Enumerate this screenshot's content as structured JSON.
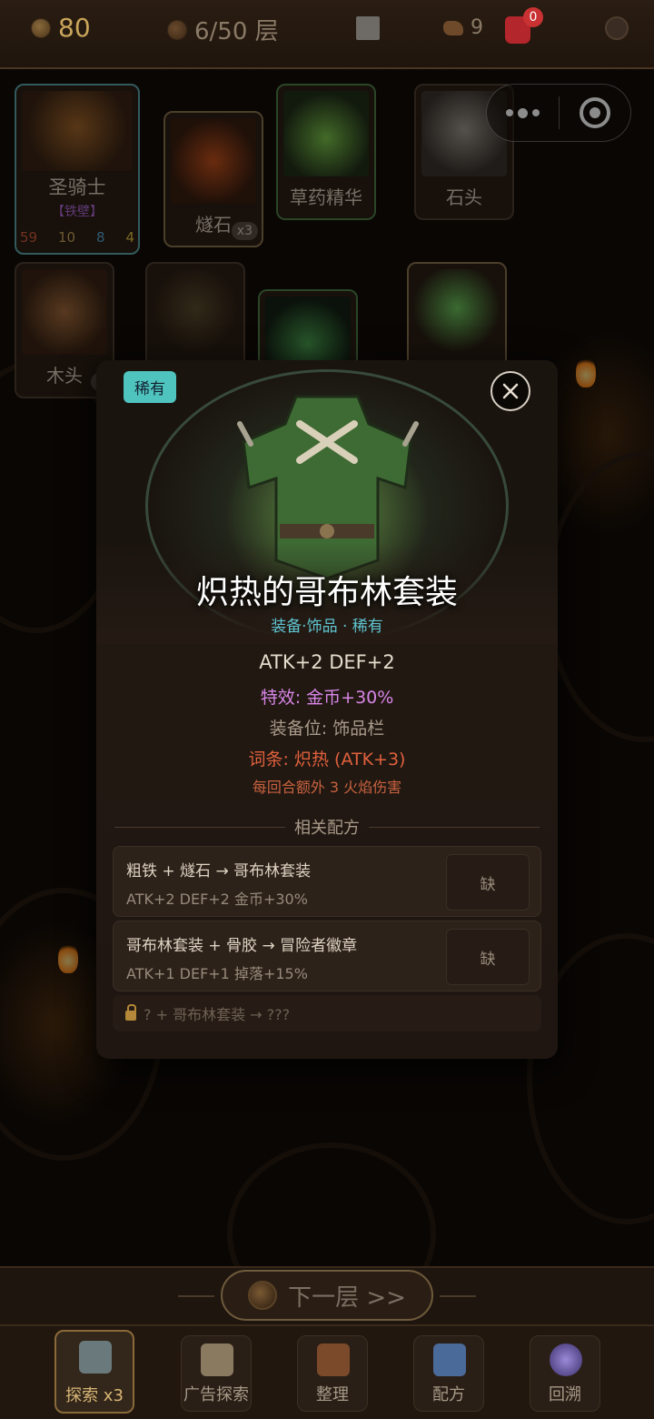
{
  "topbar": {
    "gold": "80",
    "floor": "6/50 层",
    "ore": "9",
    "bag_badge": "0"
  },
  "cards": {
    "knight": {
      "name": "圣骑士",
      "tag": "【铁壁】",
      "hp": "59",
      "gold": "10",
      "def": "8",
      "atk": "4"
    },
    "flint": {
      "name": "燧石",
      "count": "x3"
    },
    "herb": {
      "name": "草药精华"
    },
    "stone": {
      "name": "石头"
    },
    "wood": {
      "name": "木头",
      "count": "x"
    }
  },
  "modal": {
    "rarity_tag": "稀有",
    "title": "炽热的哥布林套装",
    "subtitle": "装备·饰品 · 稀有",
    "stats": "ATK+2  DEF+2",
    "effect": "特效: 金币+30%",
    "slot": "装备位: 饰品栏",
    "affix": "词条: 炽热 (ATK+3)",
    "affix_desc": "每回合额外 3 火焰伤害",
    "section_title": "相关配方",
    "recipes": [
      {
        "formula": "粗铁 + 燧石 → 哥布林套装",
        "result": "ATK+2 DEF+2 金币+30%",
        "button": "缺"
      },
      {
        "formula": "哥布林套装 + 骨胶 → 冒险者徽章",
        "result": "ATK+1 DEF+1 掉落+15%",
        "button": "缺"
      }
    ],
    "locked": "? + 哥布林套装 → ???"
  },
  "next_floor": "下一层 >>",
  "tabs": [
    {
      "label": "探索 x3"
    },
    {
      "label": "广告探索"
    },
    {
      "label": "整理"
    },
    {
      "label": "配方"
    },
    {
      "label": "回溯"
    }
  ],
  "colors": {
    "rare": "#4fc3bd",
    "effect": "#d786e6",
    "affix": "#e0613c",
    "accent_gold": "#c9a55a"
  }
}
